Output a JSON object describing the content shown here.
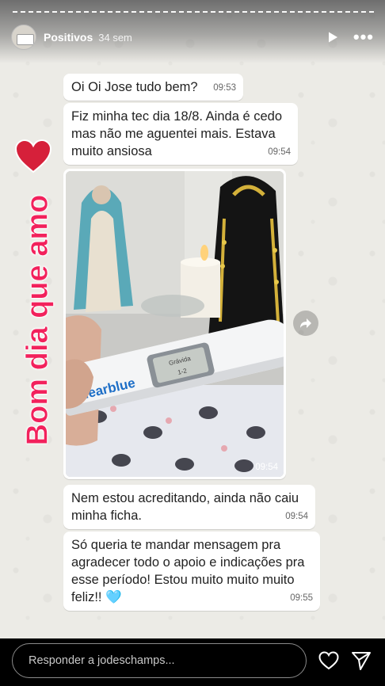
{
  "header": {
    "username": "Positivos",
    "time": "34 sem",
    "play_icon": "play-icon",
    "more_icon": "more-icon",
    "more_label": "•••"
  },
  "sticker": {
    "heart_icon": "heart-icon",
    "text": "Bom dia que amo",
    "color": "#f2215c"
  },
  "chat": {
    "messages": [
      {
        "text": "Oi Oi Jose tudo bem?",
        "time": "09:53"
      },
      {
        "text": "Fiz minha tec dia 18/8. Ainda é cedo mas não me aguentei mais. Estava muito ansiosa",
        "time": "09:54"
      },
      {
        "type": "image",
        "brand": "Clearblue",
        "display_line1": "Grávida",
        "display_line2": "1-2",
        "time": "09:54"
      },
      {
        "text": "Nem estou acreditando, ainda não caiu minha ficha.",
        "time": "09:54"
      },
      {
        "text": "Só queria te mandar mensagem pra agradecer todo o apoio e indicações pra esse período! Estou muito muito muito feliz!! 🩵",
        "time": "09:55"
      }
    ],
    "forward_icon": "forward-icon"
  },
  "footer": {
    "reply_placeholder": "Responder a jodeschamps...",
    "like_icon": "heart-outline-icon",
    "send_icon": "send-icon"
  }
}
